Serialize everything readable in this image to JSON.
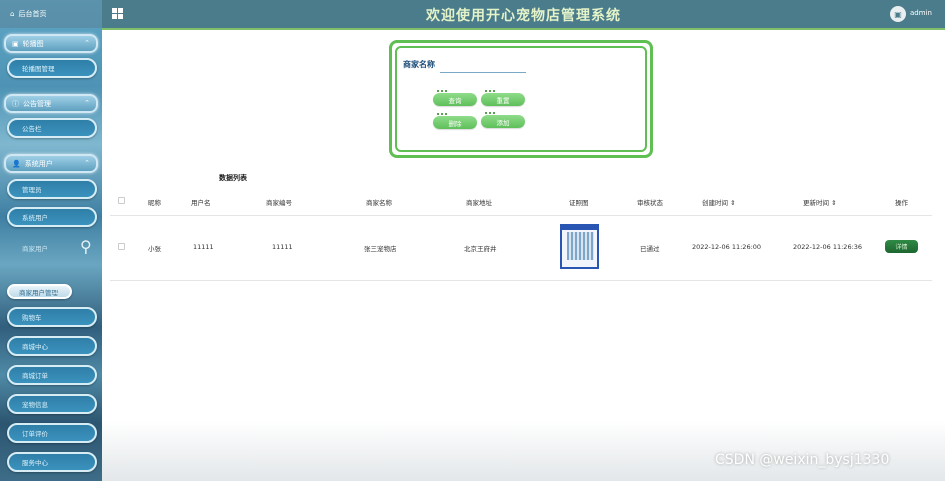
{
  "header": {
    "title": "欢迎使用开心宠物店管理系统",
    "user": "admin"
  },
  "sidebar": {
    "home": "后台首页",
    "groups": [
      {
        "label": "轮播图",
        "items": [
          "轮播图管理"
        ]
      },
      {
        "label": "公告管理",
        "items": [
          "公告栏"
        ]
      },
      {
        "label": "系统用户",
        "items": [
          "管理员",
          "系统用户",
          "商家用户",
          "商家用户管理"
        ]
      }
    ],
    "items": [
      "购物车",
      "商城中心",
      "商城订单",
      "宠物信息",
      "订单评价",
      "服务中心"
    ]
  },
  "search": {
    "label": "商家名称",
    "value": "",
    "placeholder": ""
  },
  "buttons": {
    "query": "查询",
    "reset": "重置",
    "delete": "删除",
    "add": "添加"
  },
  "table": {
    "title": "数据列表",
    "columns": [
      "昵称",
      "用户名",
      "商家编号",
      "商家名称",
      "商家地址",
      "证照图",
      "审核状态",
      "创建时间 ⇕",
      "更新时间 ⇕",
      "操作"
    ],
    "rows": [
      {
        "nickname": "小张",
        "username": "11111",
        "shop_no": "11111",
        "shop_name": "张三宠物店",
        "address": "北京王府井",
        "status": "已通过",
        "created": "2022-12-06 11:26:00",
        "updated": "2022-12-06 11:26:36",
        "action": "详情"
      }
    ]
  },
  "watermark": "CSDN @weixin_bysj1330",
  "colors": {
    "topbar": "#4a7c8c",
    "accent_green": "#5fbf52",
    "title": "#e4f3c8",
    "detail_button": "#2f8a45"
  }
}
